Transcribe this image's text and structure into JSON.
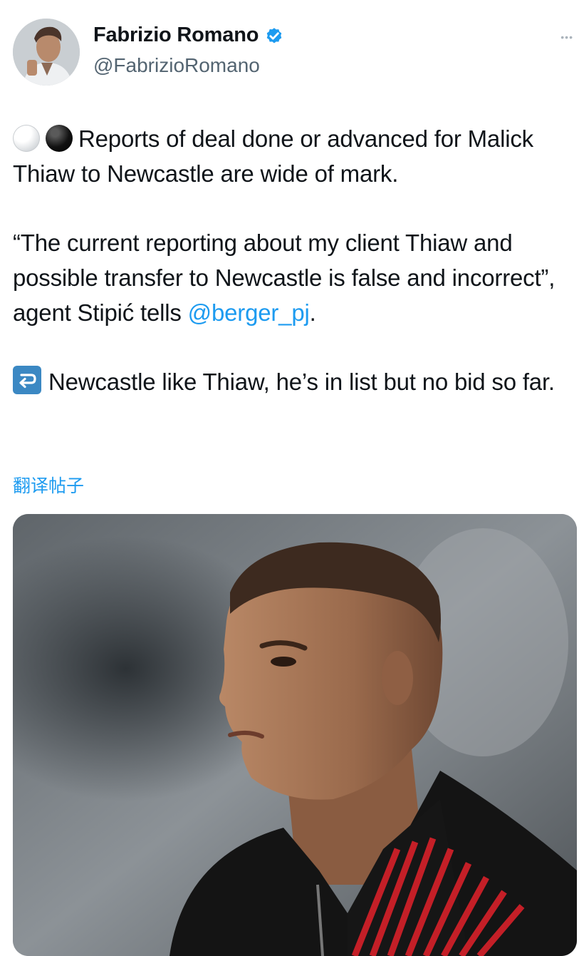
{
  "author": {
    "display_name": "Fabrizio Romano",
    "handle": "@FabrizioRomano",
    "verified": true,
    "avatar_icon": "profile-photo"
  },
  "menu": {
    "label": "•••"
  },
  "tweet": {
    "line1": {
      "emojis": [
        "white-circle-emoji",
        "black-circle-emoji"
      ],
      "text": "Reports of deal done or advanced for Malick Thiaw to Newcastle are wide of mark."
    },
    "line2": {
      "text_before": "“The current reporting about my client Thiaw and possible transfer to Newcastle is false and incorrect”, agent Stipić tells ",
      "mention": "@berger_pj",
      "text_after": "."
    },
    "line3": {
      "emoji": "right-arrow-curving-left-emoji",
      "text": "Newcastle like Thiaw, he’s in list but no bid so far."
    }
  },
  "translate_label": "翻译帖子",
  "media": {
    "description_icon": "player-photo"
  },
  "colors": {
    "accent": "#1d9bf0",
    "text": "#0f1419",
    "secondary": "#536471"
  }
}
